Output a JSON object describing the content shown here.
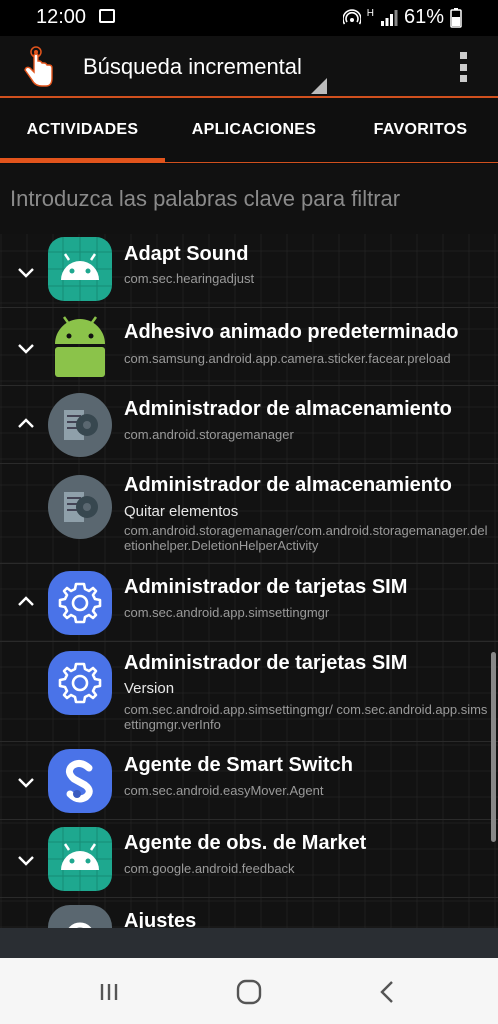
{
  "status_bar": {
    "time": "12:00",
    "network": "H",
    "battery": "61%"
  },
  "app_bar": {
    "title": "Búsqueda incremental"
  },
  "tabs": [
    {
      "label": "ACTIVIDADES"
    },
    {
      "label": "APLICACIONES"
    },
    {
      "label": "FAVORITOS"
    }
  ],
  "search": {
    "placeholder": "Introduzca las palabras clave para filtrar",
    "value": ""
  },
  "items": [
    {
      "name": "Adapt Sound",
      "sub": "",
      "package": "com.sec.hearingadjust",
      "icon": "android-icon",
      "chevron": "down"
    },
    {
      "name": "Adhesivo animado predeterminado",
      "sub": "",
      "package": "com.samsung.android.app.camera.sticker.facear.preload",
      "icon": "android-icon",
      "chevron": "down"
    },
    {
      "name": "Administrador de almacenamiento",
      "sub": "",
      "package": "com.android.storagemanager",
      "icon": "storage-gear-icon",
      "chevron": "up"
    },
    {
      "name": "Administrador de almacenamiento",
      "sub": "Quitar elementos",
      "package": "com.android.storagemanager/com.android.storagemanager.deletionhelper.DeletionHelperActivity",
      "icon": "storage-gear-icon",
      "chevron": ""
    },
    {
      "name": "Administrador de tarjetas SIM",
      "sub": "",
      "package": "com.sec.android.app.simsettingmgr",
      "icon": "settings-gear-icon",
      "chevron": "up"
    },
    {
      "name": "Administrador de tarjetas SIM",
      "sub": "Version",
      "package": "com.sec.android.app.simsettingmgr/ com.sec.android.app.simsettingmgr.verInfo",
      "icon": "settings-gear-icon",
      "chevron": ""
    },
    {
      "name": "Agente de Smart Switch",
      "sub": "",
      "package": "com.sec.android.easyMover.Agent",
      "icon": "smart-switch-icon",
      "chevron": "down"
    },
    {
      "name": "Agente de obs. de Market",
      "sub": "",
      "package": "com.google.android.feedback",
      "icon": "android-icon",
      "chevron": "down"
    },
    {
      "name": "Ajustes",
      "sub": "",
      "package": "",
      "icon": "settings-gear-icon",
      "chevron": ""
    }
  ],
  "colors": {
    "accent": "#e2541c",
    "teal": "#1ea88f",
    "android_green": "#8bc34a",
    "blue": "#4a73e8"
  }
}
